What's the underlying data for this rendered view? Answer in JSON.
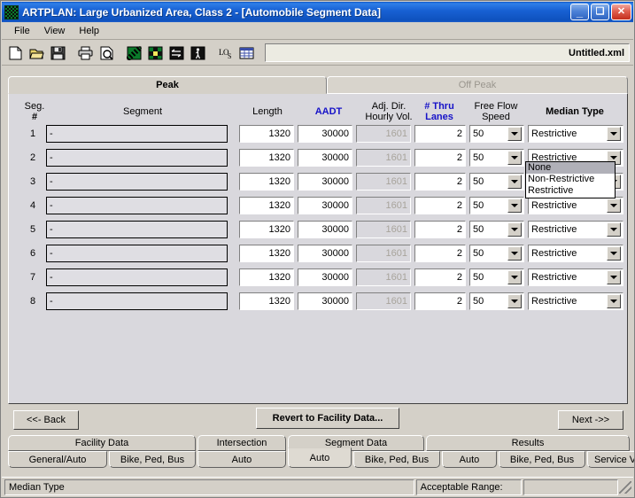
{
  "window": {
    "title": "ARTPLAN: Large Urbanized Area, Class 2 - [Automobile Segment Data]",
    "app_icon": "artplan-icon",
    "minimize": "_",
    "maximize": "❑",
    "close": "✕"
  },
  "menu": {
    "items": [
      {
        "label": "File"
      },
      {
        "label": "View"
      },
      {
        "label": "Help"
      }
    ]
  },
  "toolbar": {
    "buttons": [
      {
        "name": "new-file-icon",
        "title": "New"
      },
      {
        "name": "open-folder-icon",
        "title": "Open"
      },
      {
        "name": "save-disk-icon",
        "title": "Save"
      },
      {
        "name": "print-icon",
        "title": "Print"
      },
      {
        "name": "print-preview-icon",
        "title": "Print Preview"
      },
      {
        "name": "facility-green-icon",
        "title": "Facility"
      },
      {
        "name": "intersection-grid-icon",
        "title": "Intersection"
      },
      {
        "name": "segment-arrows-icon",
        "title": "Segment"
      },
      {
        "name": "pedestrian-icon",
        "title": "Pedestrian"
      },
      {
        "name": "los-icon",
        "title": "LOS"
      },
      {
        "name": "table-report-icon",
        "title": "Report"
      }
    ],
    "filename": "Untitled.xml"
  },
  "tabs": {
    "items": [
      {
        "label": "Peak",
        "active": true,
        "disabled": false
      },
      {
        "label": "Off Peak",
        "active": false,
        "disabled": true
      }
    ]
  },
  "grid": {
    "headers": [
      {
        "line1": "Seg.",
        "line2": "#",
        "color": "black",
        "bold": false
      },
      {
        "line1": "Segment",
        "line2": "",
        "color": "black",
        "bold": false
      },
      {
        "line1": "Length",
        "line2": "",
        "color": "black",
        "bold": false
      },
      {
        "line1": "AADT",
        "line2": "",
        "color": "blue",
        "bold": true
      },
      {
        "line1": "Adj. Dir.",
        "line2": "Hourly Vol.",
        "color": "black",
        "bold": false
      },
      {
        "line1": "# Thru",
        "line2": "Lanes",
        "color": "blue",
        "bold": true
      },
      {
        "line1": "Free Flow",
        "line2": "Speed",
        "color": "black",
        "bold": false
      },
      {
        "line1": "Median Type",
        "line2": "",
        "color": "black",
        "bold": true
      }
    ],
    "rows": [
      {
        "num": "1",
        "segment": "-",
        "length": "1320",
        "aadt": "30000",
        "adj_dir_hourly_vol": "1601",
        "thru_lanes": "2",
        "free_flow_speed": "50",
        "median_type": "Restrictive"
      },
      {
        "num": "2",
        "segment": "-",
        "length": "1320",
        "aadt": "30000",
        "adj_dir_hourly_vol": "1601",
        "thru_lanes": "2",
        "free_flow_speed": "50",
        "median_type": "Restrictive"
      },
      {
        "num": "3",
        "segment": "-",
        "length": "1320",
        "aadt": "30000",
        "adj_dir_hourly_vol": "1601",
        "thru_lanes": "2",
        "free_flow_speed": "50",
        "median_type": "Restrictive"
      },
      {
        "num": "4",
        "segment": "-",
        "length": "1320",
        "aadt": "30000",
        "adj_dir_hourly_vol": "1601",
        "thru_lanes": "2",
        "free_flow_speed": "50",
        "median_type": "Restrictive"
      },
      {
        "num": "5",
        "segment": "-",
        "length": "1320",
        "aadt": "30000",
        "adj_dir_hourly_vol": "1601",
        "thru_lanes": "2",
        "free_flow_speed": "50",
        "median_type": "Restrictive"
      },
      {
        "num": "6",
        "segment": "-",
        "length": "1320",
        "aadt": "30000",
        "adj_dir_hourly_vol": "1601",
        "thru_lanes": "2",
        "free_flow_speed": "50",
        "median_type": "Restrictive"
      },
      {
        "num": "7",
        "segment": "-",
        "length": "1320",
        "aadt": "30000",
        "adj_dir_hourly_vol": "1601",
        "thru_lanes": "2",
        "free_flow_speed": "50",
        "median_type": "Restrictive"
      },
      {
        "num": "8",
        "segment": "-",
        "length": "1320",
        "aadt": "30000",
        "adj_dir_hourly_vol": "1601",
        "thru_lanes": "2",
        "free_flow_speed": "50",
        "median_type": "Restrictive"
      }
    ]
  },
  "median_dropdown": {
    "open": true,
    "owner_row": 2,
    "options": [
      {
        "label": "None",
        "selected": true
      },
      {
        "label": "Non-Restrictive",
        "selected": false
      },
      {
        "label": "Restrictive",
        "selected": false
      }
    ]
  },
  "nav": {
    "back": "<<- Back",
    "revert": "Revert to Facility Data...",
    "next": "Next ->>"
  },
  "bottom_tabs": {
    "groups": [
      {
        "label": "Facility Data"
      },
      {
        "label": "Intersection"
      },
      {
        "label": "Segment Data"
      },
      {
        "label": "Results"
      }
    ],
    "subtabs": [
      {
        "label": "General/Auto",
        "active": false
      },
      {
        "label": "Bike, Ped, Bus",
        "active": false
      },
      {
        "label": "Auto",
        "active": false
      },
      {
        "label": "Auto",
        "active": true
      },
      {
        "label": "Bike, Ped, Bus",
        "active": false
      },
      {
        "label": "Auto",
        "active": false
      },
      {
        "label": "Bike, Ped, Bus",
        "active": false
      },
      {
        "label": "Service Volumes",
        "active": false
      }
    ]
  },
  "statusbar": {
    "message": "Median Type",
    "range_label": "Acceptable Range:",
    "range_value": ""
  },
  "colors": {
    "titlebar_blue": "#1861d4",
    "header_blue": "#1612c8",
    "panel_bg": "#d9d8dd",
    "chrome": "#d4d0c8"
  }
}
